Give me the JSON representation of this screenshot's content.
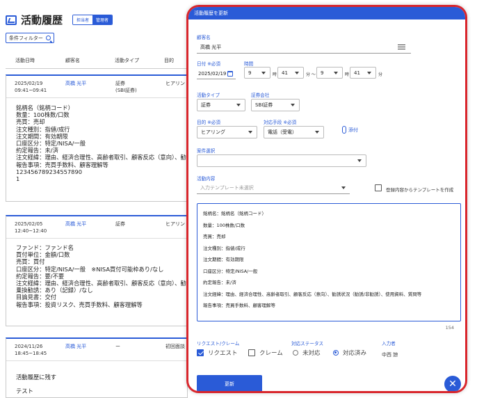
{
  "page": {
    "title": "活動履歴",
    "roles": [
      "担当者",
      "管理者"
    ],
    "filter_label": "条件フィルター",
    "columns": [
      "活動日時",
      "顧客名",
      "活動タイプ",
      "目的"
    ]
  },
  "cards": [
    {
      "date": "2025/02/19",
      "time": "09:41~09:41",
      "customer": "高橋 光平",
      "type": "証券",
      "type_sub": "(SBI証券)",
      "purpose": "ヒアリン",
      "body": "銘柄名（銘柄コード）\n数量：100株数/口数\n売買：売却\n注文種別：指値/成行\n注文期間：有効期限\n口座区分：特定/NISA/一般\n約定報告：未/済\n注文経緯：理由、経済合理性、高齢者取引、顧客反応（意向）、勧\n報告事項：売買手数料、顧客理解等\n123456789234557890\n1"
    },
    {
      "date": "2025/02/05",
      "time": "12:40~12:40",
      "customer": "高橋 光平",
      "type": "証券",
      "type_sub": "",
      "purpose": "ヒアリン",
      "body": "ファンド：ファンド名\n買付単位：金額/口数\n売買：買付\n口座区分：特定/NISA/一般　※NISA買付可能枠あり/なし\n約定報告：要/不要\n注文経緯：理由、経済合理性、高齢者取引、顧客反応（意向）、勧\n乗換勧誘：あり（記録）/なし\n目論見書：交付\n報告事項：投資リスク、売買手数料、顧客理解等"
    },
    {
      "date": "2024/11/26",
      "time": "18:45~18:45",
      "customer": "高橋 光平",
      "type": "ー",
      "type_sub": "",
      "purpose": "初回面談",
      "body": "活動履歴に残す\n\nテスト"
    }
  ],
  "modal": {
    "title": "活動履歴を更新",
    "customer_label": "顧客名",
    "customer_value": "高橋 光平",
    "date_label": "日付 ※必須",
    "date_value": "2025/02/19",
    "time_label": "時間",
    "start_hour": "9",
    "start_min": "41",
    "end_hour": "9",
    "end_min": "41",
    "hour_unit": "時",
    "min_unit": "分",
    "tilde": "分 〜",
    "activity_type_label": "活動タイプ",
    "activity_type_value": "証券",
    "securities_label": "証券会社",
    "securities_value": "SBI証券",
    "purpose_label": "目的 ※必須",
    "purpose_value": "ヒアリング",
    "channel_label": "対応手段 ※必須",
    "channel_value": "電話（受電）",
    "attach_label": "添付",
    "deal_label": "案件選択",
    "deal_value": "",
    "content_label": "活動内容",
    "template_placeholder": "入力テンプレート未選択",
    "save_template_label": "登録内容からテンプレートを作成",
    "content_text": "銘柄名：銘柄名（銘柄コード）\n数量：100株数/口数\n売買：売却\n注文種別：指値/成行\n注文期間：有効期限\n口座区分：特定/NISA/一般\n約定報告：未/済\n注文経緯：理由、経済合理性、高齢者取引、顧客反応（意向）、勧誘状況（勧誘/非勧誘）、使用資料、質問等\n報告事項：売買手数料、顧客理解等",
    "char_count": "154",
    "request_claim_label": "リクエスト/クレーム",
    "request_label": "リクエスト",
    "claim_label": "クレーム",
    "status_label": "対応ステータス",
    "status_pending": "未対応",
    "status_done": "対応済み",
    "inputter_label": "入力者",
    "inputter_value": "中西 諒",
    "update_label": "更新",
    "fab_symbol": "✕"
  },
  "colors": {
    "accent": "#2a5bd7",
    "highlight": "#d9262c"
  }
}
